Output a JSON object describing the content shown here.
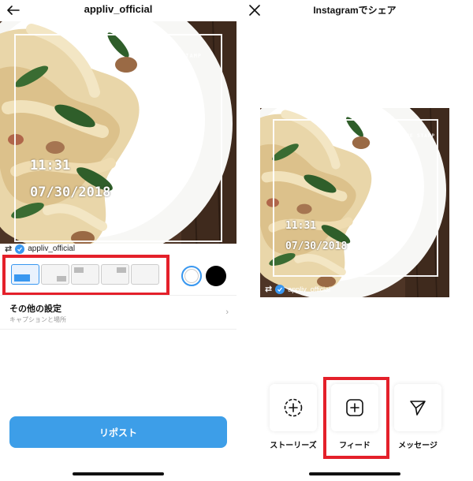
{
  "left": {
    "header": {
      "title": "appliv_official",
      "back_icon": "back-arrow-icon"
    },
    "photo": {
      "brand_stamp": "TIME STAMP",
      "time": "11:31",
      "date": "07/30/2018"
    },
    "credit": {
      "username": "appliv_official"
    },
    "layout_options": [
      "bottom-left",
      "bottom-right",
      "top-left",
      "top-right",
      "plain"
    ],
    "colors": {
      "white": "#ffffff",
      "black": "#000000",
      "selected": "white"
    },
    "settings": {
      "title": "その他の設定",
      "subtitle": "キャプションと場所"
    },
    "repost_button": "リポスト",
    "accent": "#3d9ee8",
    "highlight_color": "#e4202a"
  },
  "right": {
    "header": {
      "title": "Instagramでシェア",
      "close_icon": "close-x-icon"
    },
    "photo": {
      "brand_stamp": "TIME STAMP",
      "time": "11:31",
      "date": "07/30/2018"
    },
    "credit": {
      "username": "appliv_official"
    },
    "share_options": [
      {
        "label": "ストーリーズ",
        "icon": "story-plus-icon"
      },
      {
        "label": "フィード",
        "icon": "feed-plus-icon"
      },
      {
        "label": "メッセージ",
        "icon": "paper-plane-icon"
      }
    ]
  }
}
